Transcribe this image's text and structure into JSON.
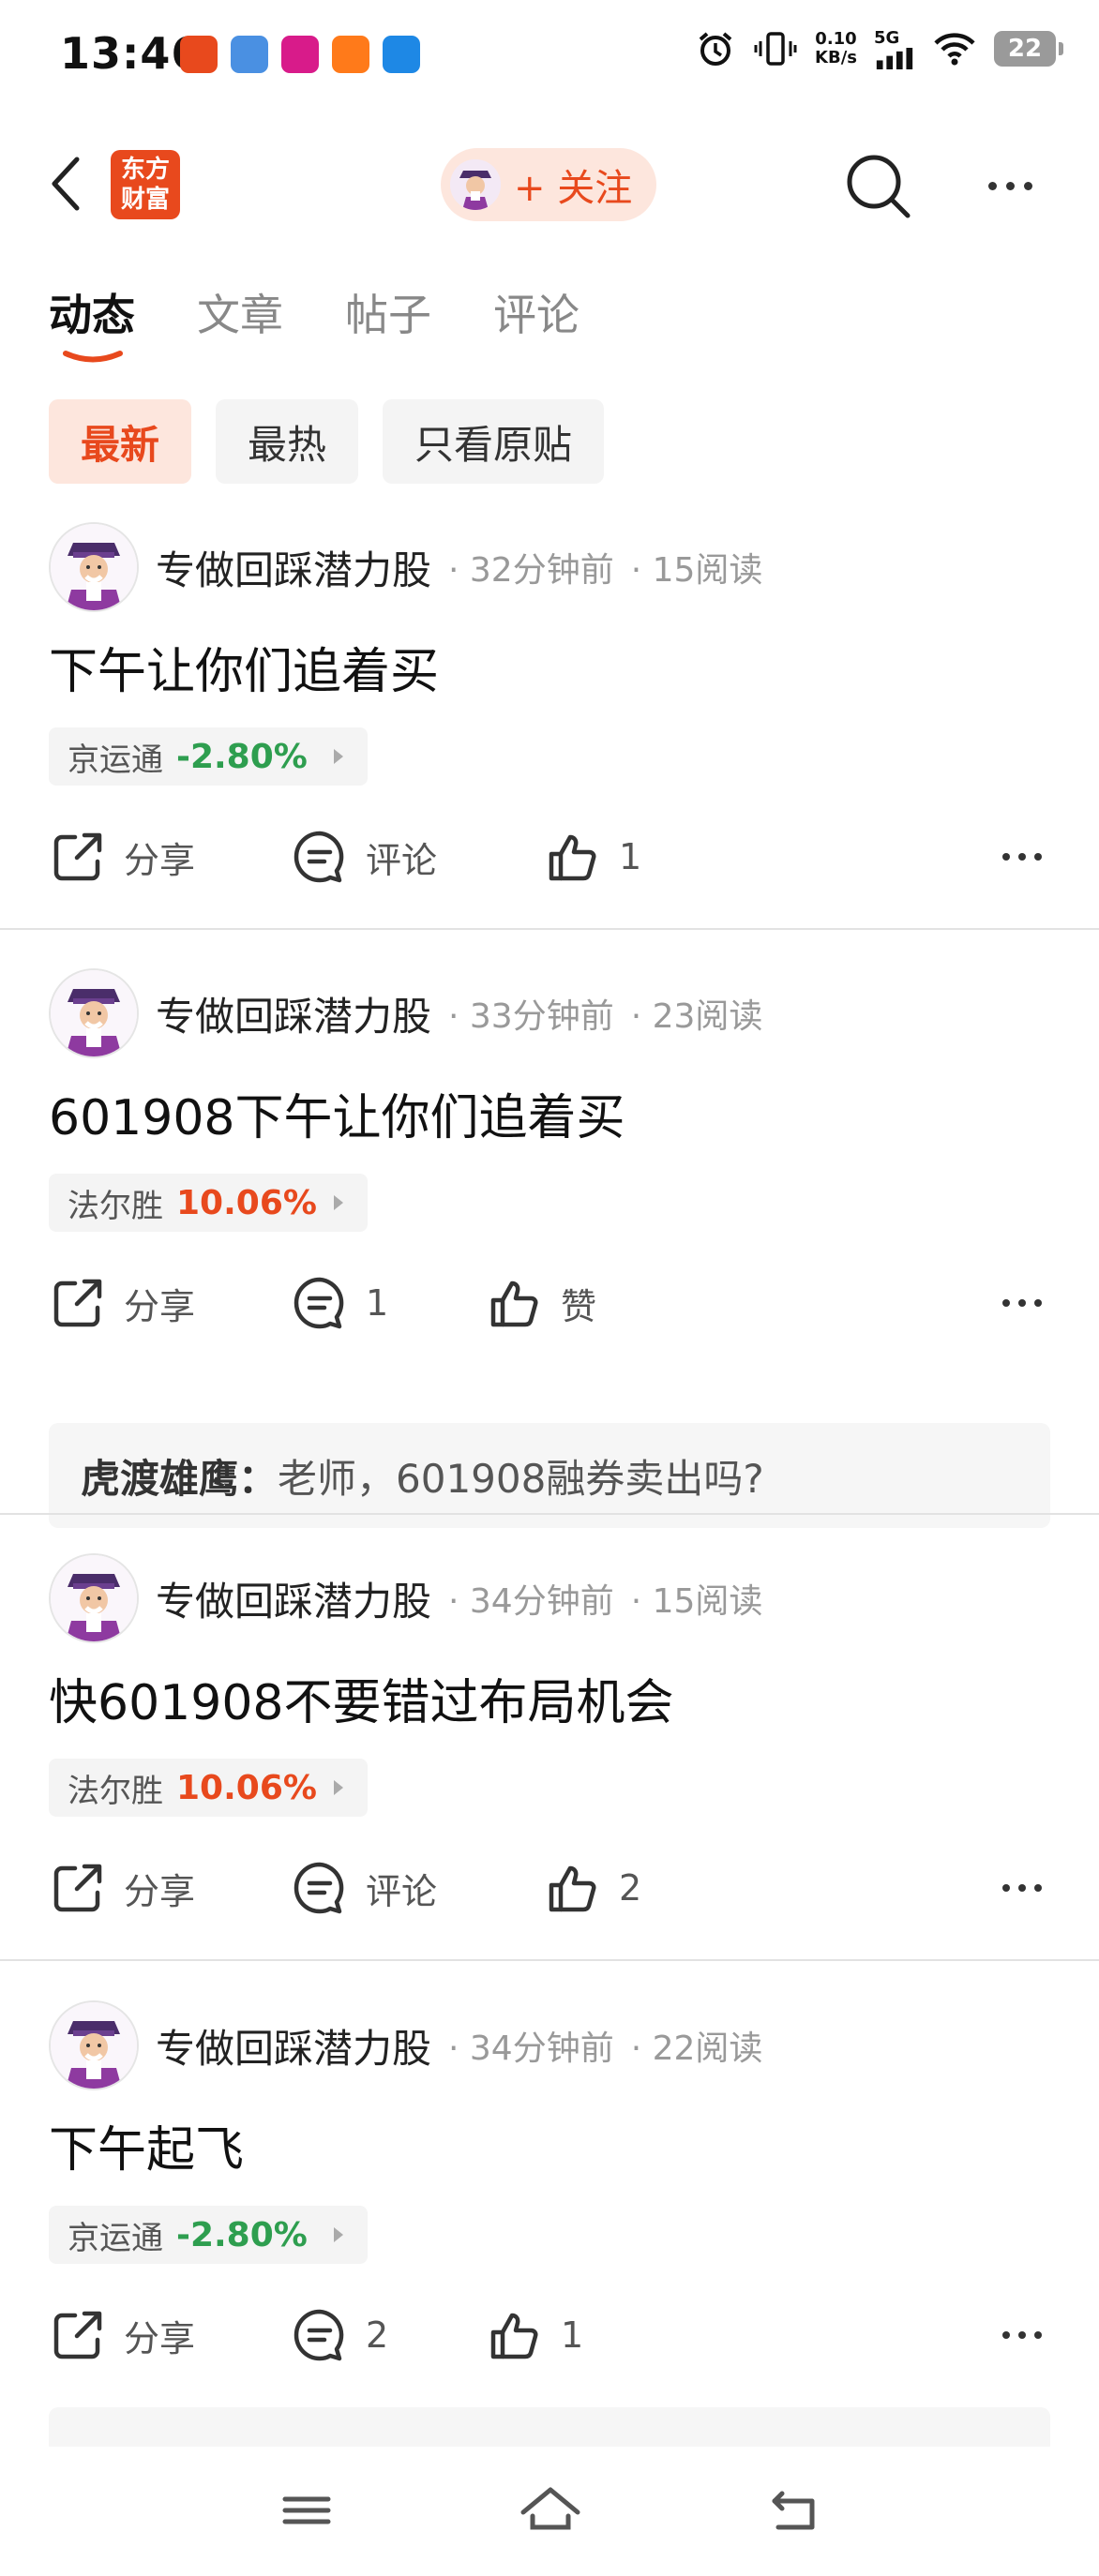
{
  "status_bar": {
    "time": "13:46",
    "net_speed_value": "0.10",
    "net_speed_unit": "KB/s",
    "signal_type": "5G",
    "battery": "22",
    "app_icon_colors": [
      "#e8491d",
      "#4a90e2",
      "#d81b8a",
      "#ff7a1a",
      "#1e88e5"
    ]
  },
  "header": {
    "logo_line1": "东方",
    "logo_line2": "财富",
    "follow_label": "+ 关注"
  },
  "tabs": [
    {
      "label": "动态",
      "active": true
    },
    {
      "label": "文章",
      "active": false
    },
    {
      "label": "帖子",
      "active": false
    },
    {
      "label": "评论",
      "active": false
    }
  ],
  "filters": [
    {
      "label": "最新",
      "active": true
    },
    {
      "label": "最热",
      "active": false
    },
    {
      "label": "只看原贴",
      "active": false
    }
  ],
  "colors": {
    "accent": "#e8491d",
    "stock_down": "#2e9e4f",
    "stock_up": "#e8491d"
  },
  "posts": [
    {
      "author": "专做回踩潜力股",
      "time": "· 32分钟前",
      "reads": "· 15阅读",
      "text": "下午让你们追着买",
      "stock_name": "京运通",
      "stock_change": "-2.80%",
      "stock_trend": "down",
      "share_label": "分享",
      "comment_label": "评论",
      "like_label": "1"
    },
    {
      "author": "专做回踩潜力股",
      "time": "· 33分钟前",
      "reads": "· 23阅读",
      "text": "601908下午让你们追着买",
      "stock_name": "法尔胜",
      "stock_change": "10.06%",
      "stock_trend": "up",
      "share_label": "分享",
      "comment_label": "1",
      "like_label": "赞",
      "reply_user": "虎渡雄鹰：",
      "reply_text": "老师，601908融券卖出吗?"
    },
    {
      "author": "专做回踩潜力股",
      "time": "· 34分钟前",
      "reads": "· 15阅读",
      "text": "快601908不要错过布局机会",
      "stock_name": "法尔胜",
      "stock_change": "10.06%",
      "stock_trend": "up",
      "share_label": "分享",
      "comment_label": "评论",
      "like_label": "2"
    },
    {
      "author": "专做回踩潜力股",
      "time": "· 34分钟前",
      "reads": "· 22阅读",
      "text": "下午起飞",
      "stock_name": "京运通",
      "stock_change": "-2.80%",
      "stock_trend": "down",
      "share_label": "分享",
      "comment_label": "2",
      "like_label": "1"
    }
  ]
}
